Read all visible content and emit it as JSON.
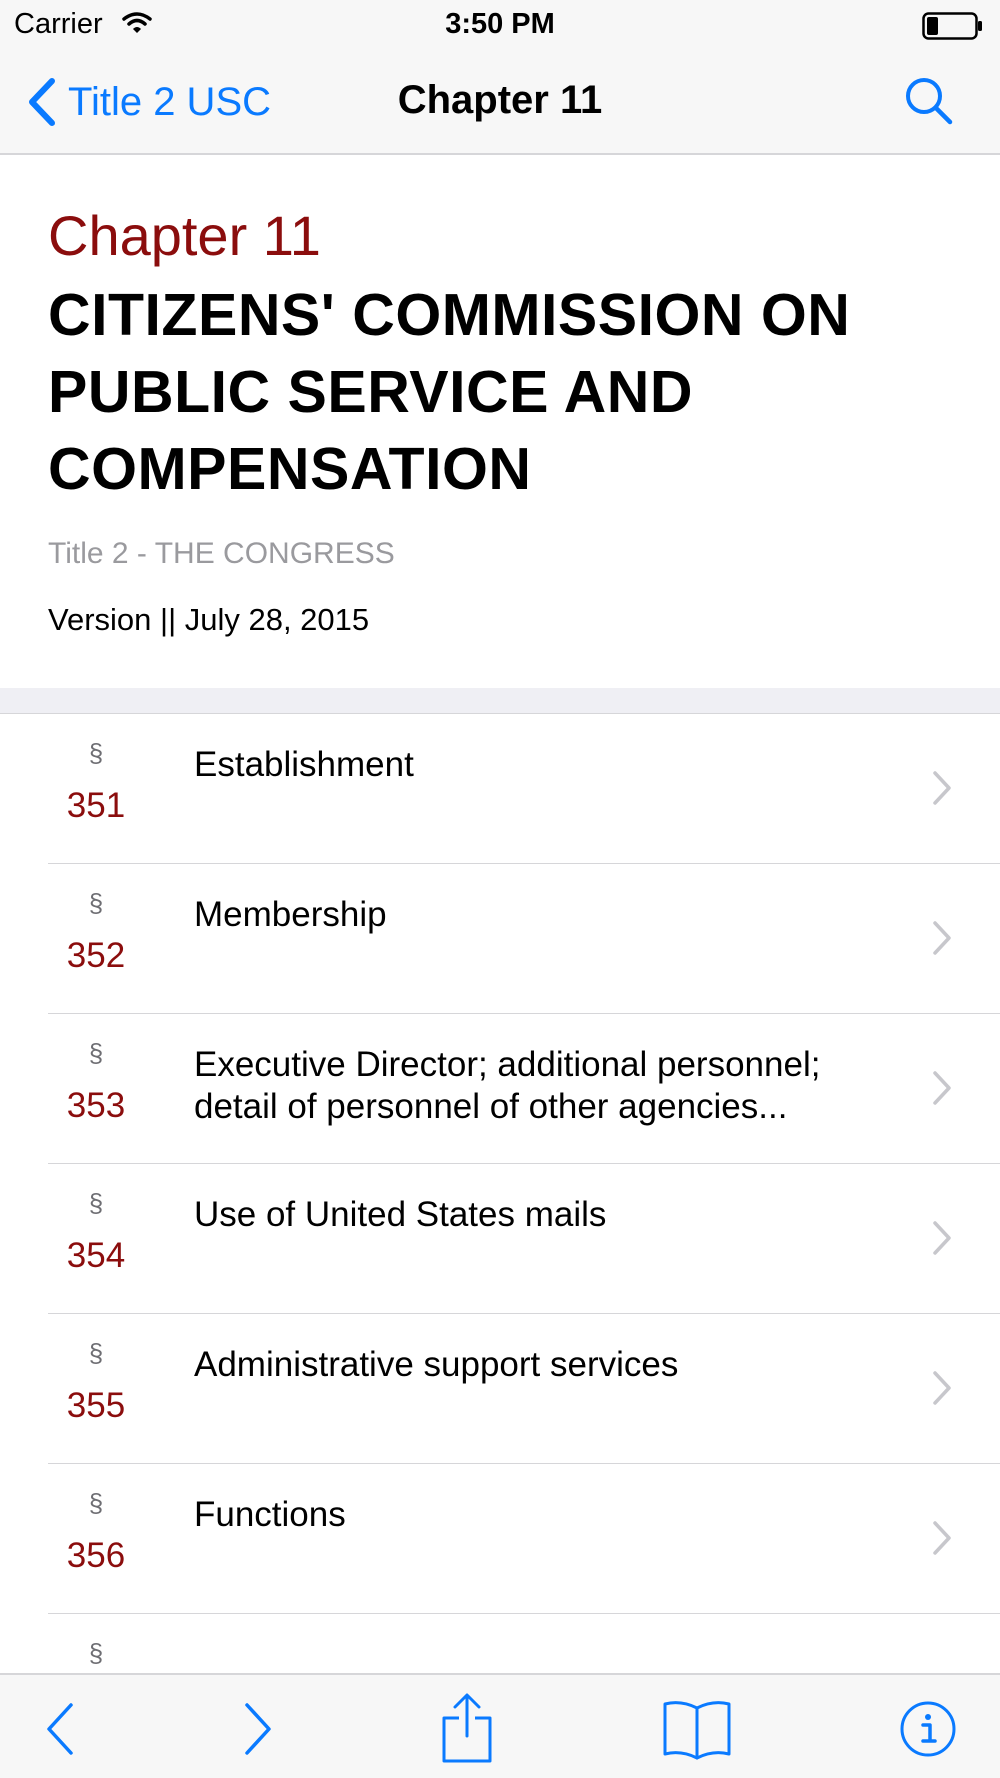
{
  "status_bar": {
    "carrier": "Carrier",
    "time": "3:50 PM"
  },
  "nav": {
    "back_label": "Title 2 USC",
    "title": "Chapter 11"
  },
  "header": {
    "chapter_label": "Chapter 11",
    "chapter_name": "CITIZENS' COMMISSION ON PUBLIC SERVICE AND COMPENSATION",
    "title_line": "Title 2 - THE CONGRESS",
    "version_line": "Version || July 28, 2015"
  },
  "sections": [
    {
      "symbol": "§",
      "number": "351",
      "title": "Establishment"
    },
    {
      "symbol": "§",
      "number": "352",
      "title": "Membership"
    },
    {
      "symbol": "§",
      "number": "353",
      "title": "Executive Director; additional personnel; detail of personnel of other agencies..."
    },
    {
      "symbol": "§",
      "number": "354",
      "title": "Use of United States mails"
    },
    {
      "symbol": "§",
      "number": "355",
      "title": "Administrative support services"
    },
    {
      "symbol": "§",
      "number": "356",
      "title": "Functions"
    },
    {
      "symbol": "§",
      "number": "",
      "title": ""
    }
  ],
  "toolbar": {
    "icons": [
      "back-icon",
      "forward-icon",
      "share-icon",
      "bookmarks-icon",
      "info-icon"
    ]
  },
  "colors": {
    "accent": "#0a7aff",
    "section_red": "#8b0d0d"
  }
}
